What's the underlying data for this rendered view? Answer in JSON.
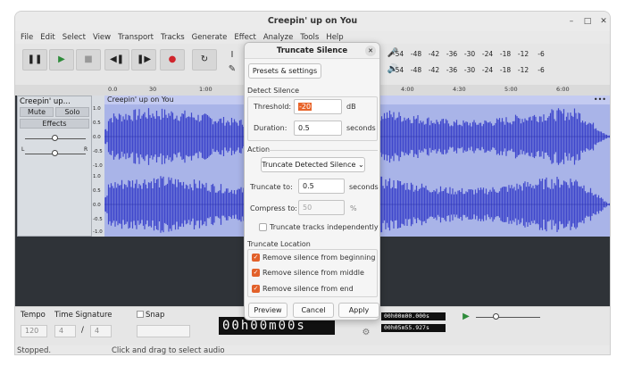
{
  "window": {
    "title": "Creepin' up on You"
  },
  "menu": [
    "File",
    "Edit",
    "Select",
    "View",
    "Transport",
    "Tracks",
    "Generate",
    "Effect",
    "Analyze",
    "Tools",
    "Help"
  ],
  "meters": {
    "scale": [
      "-54",
      "-48",
      "-42",
      "-36",
      "-30",
      "-24",
      "-18",
      "-12",
      "-6"
    ],
    "play_label_l": "L",
    "play_label_r": "R"
  },
  "ruler": [
    "0.0",
    "30",
    "1:00",
    "4:00",
    "4:30",
    "5:00",
    "6:00"
  ],
  "track": {
    "name": "Creepin' up...",
    "mute": "Mute",
    "solo": "Solo",
    "effects": "Effects",
    "pan_left": "L",
    "pan_right": "R",
    "clip_name": "Creepin' up on You",
    "scale_top": [
      "1.0",
      "0.5",
      "0.0",
      "-0.5",
      "-1.0"
    ],
    "scale_bottom": [
      "1.0",
      "0.5",
      "0.0",
      "-0.5",
      "-1.0"
    ]
  },
  "bottom": {
    "tempo_label": "Tempo",
    "time_sig_label": "Time Signature",
    "snap_label": "Snap",
    "tempo": "120",
    "ts_num": "4",
    "ts_sep": "/",
    "ts_den": "4",
    "time_display": "00h00m00s",
    "sel_start": "00h00m00.000s",
    "sel_end": "00h05m55.927s"
  },
  "status": {
    "left": "Stopped.",
    "hint": "Click and drag to select audio"
  },
  "dialog": {
    "title": "Truncate Silence",
    "presets": "Presets & settings",
    "detect_group": "Detect Silence",
    "threshold_label": "Threshold:",
    "threshold_value": "-20",
    "threshold_unit": "dB",
    "duration_label": "Duration:",
    "duration_value": "0.5",
    "duration_unit": "seconds",
    "action_group": "Action",
    "action_value": "Truncate Detected Silence",
    "truncate_label": "Truncate to:",
    "truncate_value": "0.5",
    "truncate_unit": "seconds",
    "compress_label": "Compress to:",
    "compress_value": "50",
    "compress_unit": "%",
    "independent_label": "Truncate tracks independently",
    "location_group": "Truncate Location",
    "loc_begin": "Remove silence from beginning",
    "loc_middle": "Remove silence from middle",
    "loc_end": "Remove silence from end",
    "preview": "Preview",
    "cancel": "Cancel",
    "apply": "Apply"
  },
  "colors": {
    "waveform": "#3f47cc",
    "waveform_bg": "#a9b4e8",
    "accent": "#e2612a"
  }
}
